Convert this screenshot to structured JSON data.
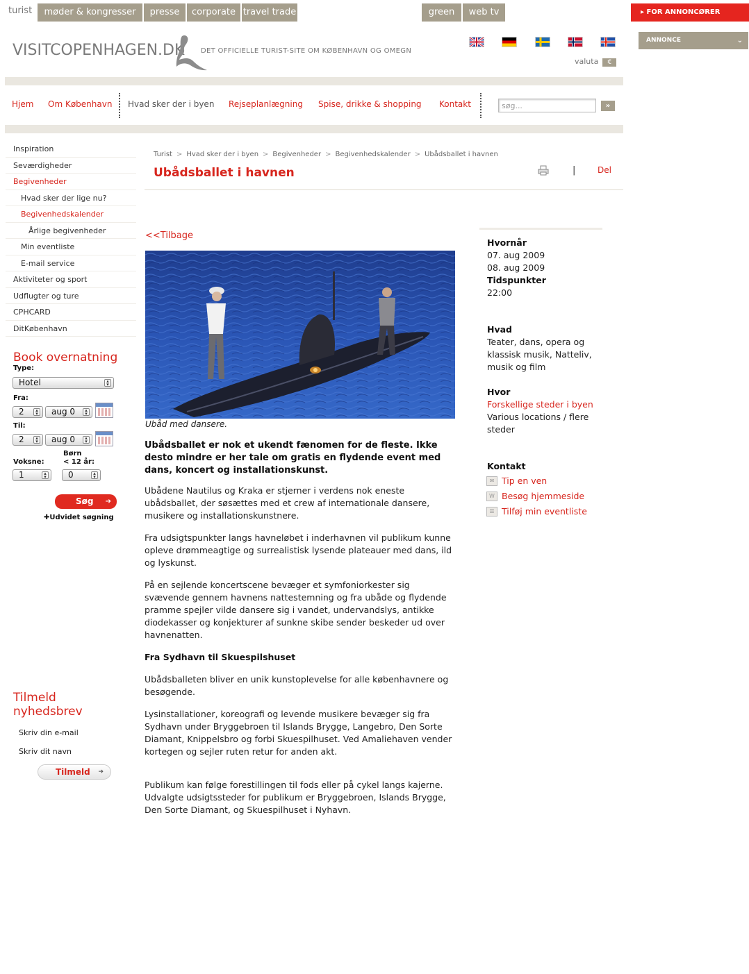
{
  "top_tabs": {
    "turist": "turist",
    "tabs": [
      "møder & kongresser",
      "presse",
      "corporate",
      "travel trade"
    ],
    "right_tabs": [
      "green",
      "web tv"
    ]
  },
  "for_annoncorer": "FOR ANNONCØRER",
  "annonce": "ANNONCE",
  "logo": {
    "text": "VISITCOPENHAGEN.DK",
    "tagline": "DET OFFICIELLE TURIST-SITE OM KØBENHAVN OG OMEGN"
  },
  "flags": [
    "uk-flag",
    "german-flag",
    "swedish-flag",
    "norwegian-flag",
    "icelandic-flag"
  ],
  "valuta": {
    "label": "valuta",
    "symbol": "€"
  },
  "nav": {
    "items": [
      "Hjem",
      "Om København",
      "Hvad sker der i byen",
      "Rejseplanlægning",
      "Spise, drikke & shopping",
      "Kontakt"
    ],
    "search_placeholder": "søg...",
    "search_button": "»"
  },
  "sidebar": {
    "items": [
      {
        "label": "Inspiration",
        "level": 0,
        "active": false
      },
      {
        "label": "Seværdigheder",
        "level": 0,
        "active": false
      },
      {
        "label": "Begivenheder",
        "level": 0,
        "active": true
      },
      {
        "label": "Hvad sker der lige nu?",
        "level": 1,
        "active": false
      },
      {
        "label": "Begivenhedskalender",
        "level": 1,
        "active": true
      },
      {
        "label": "Årlige begivenheder",
        "level": 2,
        "active": false
      },
      {
        "label": "Min eventliste",
        "level": 1,
        "active": false
      },
      {
        "label": "E-mail service",
        "level": 1,
        "active": false
      },
      {
        "label": "Aktiviteter og sport",
        "level": 0,
        "active": false
      },
      {
        "label": "Udflugter og ture",
        "level": 0,
        "active": false
      },
      {
        "label": "CPHCARD",
        "level": 0,
        "active": false
      },
      {
        "label": "DitKøbenhavn",
        "level": 0,
        "active": false
      }
    ]
  },
  "booking": {
    "title": "Book overnatning",
    "type_label": "Type:",
    "type_value": "Hotel",
    "fra_label": "Fra:",
    "fra_day": "2",
    "fra_month": "aug 0",
    "til_label": "Til:",
    "til_day": "2",
    "til_month": "aug 0",
    "voksne_label": "Voksne:",
    "born_label": "Børn",
    "born_sub_label": "< 12 år:",
    "voksne_value": "1",
    "born_value": "0",
    "search_button": "Søg",
    "advanced": "Udvidet søgning"
  },
  "newsletter": {
    "title": "Tilmeld nyhedsbrev",
    "email_field": "Skriv din e-mail",
    "name_field": "Skriv dit navn",
    "button": "Tilmeld"
  },
  "breadcrumb": [
    "Turist",
    "Hvad sker der i byen",
    "Begivenheder",
    "Begivenhedskalender",
    "Ubådsballet i havnen"
  ],
  "page_title": "Ubådsballet i havnen",
  "share": {
    "separator": "|",
    "del": "Del"
  },
  "back_link": "<<Tilbage",
  "photo_caption": "Ubåd med dansere.",
  "article": {
    "lead": "Ubådsballet er nok et ukendt fænomen for de fleste. Ikke desto mindre er her tale om gratis en flydende event med dans, koncert og installationskunst.",
    "paragraphs": [
      "Ubådene Nautilus og Kraka er stjerner i verdens nok eneste ubådsballet, der søsættes med et crew af internationale dansere, musikere og installationskunstnere.",
      "Fra udsigtspunkter langs havneløbet i inderhavnen vil publikum kunne opleve drømmeagtige og surrealistisk lysende plateauer med dans, ild og lyskunst.",
      "På en sejlende koncertscene bevæger et symfoniorkester sig svævende gennem havnens nattestemning og fra ubåde og flydende pramme spejler vilde dansere sig i vandet, undervandslys, antikke diodekasser og konjekturer af sunkne skibe sender beskeder ud over havnenatten."
    ],
    "subheading": "Fra Sydhavn til Skuespilshuset",
    "paragraphs2": [
      "Ubådsballeten bliver en unik kunstoplevelse for alle københavnere og besøgende.",
      "Lysinstallationer, koreografi og levende musikere bevæger sig fra Sydhavn under Bryggebroen til Islands Brygge, Langebro, Den Sorte Diamant, Knippelsbro og forbi Skuespilhuset. Ved Amaliehaven vender kortegen og sejler ruten retur for anden akt.",
      "Publikum kan følge forestillingen til fods eller på cykel langs kajerne. Udvalgte udsigtssteder for publikum er Bryggebroen, Islands Brygge, Den Sorte Diamant, og Skuespilhuset i Nyhavn."
    ]
  },
  "info": {
    "hvornaar_label": "Hvornår",
    "dates": [
      "07.  aug 2009",
      "08.  aug 2009"
    ],
    "tid_label": "Tidspunkter",
    "tid": "22:00",
    "hvad_label": "Hvad",
    "hvad": "Teater, dans, opera og klassisk musik, Natteliv, musik og film",
    "hvor_label": "Hvor",
    "hvor_link": "Forskellige steder i byen",
    "hvor_text": "Various locations / flere steder",
    "kontakt_label": "Kontakt",
    "kontakt_links": [
      "Tip en ven",
      "Besøg hjemmeside",
      "Tilføj min eventliste"
    ]
  }
}
